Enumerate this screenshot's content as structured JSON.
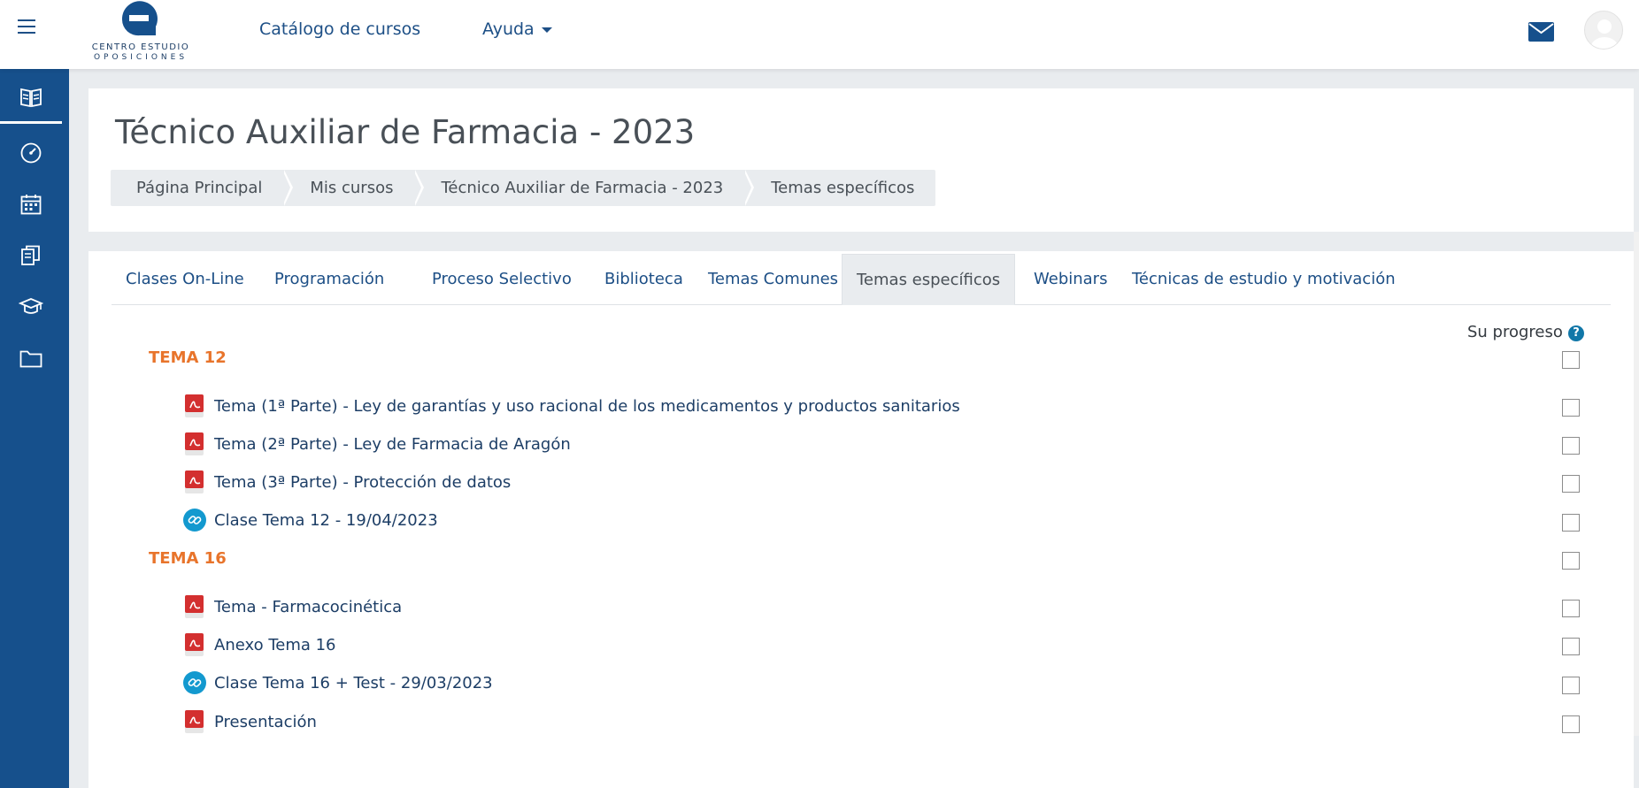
{
  "navbar": {
    "logo_line1": "CENTRO ESTUDIO",
    "logo_line2": "OPOSICIONES",
    "catalog_label": "Catálogo de cursos",
    "help_label": "Ayuda"
  },
  "rail": {
    "items": [
      {
        "icon": "book-open-icon",
        "active": true
      },
      {
        "icon": "dashboard-icon"
      },
      {
        "icon": "calendar-icon"
      },
      {
        "icon": "files-icon"
      },
      {
        "icon": "graduation-cap-icon"
      },
      {
        "icon": "folder-icon"
      }
    ]
  },
  "header": {
    "title": "Técnico Auxiliar de Farmacia - 2023",
    "breadcrumb": [
      "Página Principal",
      "Mis cursos",
      "Técnico Auxiliar de Farmacia - 2023",
      "Temas específicos"
    ]
  },
  "tabs": [
    "Clases On-Line",
    "Programación",
    "Proceso Selectivo",
    "Biblioteca",
    "Temas Comunes",
    "Temas específicos",
    "Webinars",
    "Técnicas de estudio y motivación"
  ],
  "active_tab": "Temas específicos",
  "progress_label": "Su progreso",
  "sections": [
    {
      "title": "TEMA 12",
      "activities": [
        {
          "type": "pdf",
          "label": "Tema (1ª Parte) - Ley de garantías y uso racional de los medicamentos y productos sanitarios"
        },
        {
          "type": "pdf",
          "label": "Tema (2ª Parte) - Ley de Farmacia de Aragón"
        },
        {
          "type": "pdf",
          "label": "Tema (3ª Parte) - Protección de datos"
        },
        {
          "type": "url",
          "label": "Clase Tema 12 - 19/04/2023"
        }
      ]
    },
    {
      "title": "TEMA 16",
      "activities": [
        {
          "type": "pdf",
          "label": "Tema - Farmacocinética"
        },
        {
          "type": "pdf",
          "label": "Anexo Tema 16"
        },
        {
          "type": "url",
          "label": "Clase Tema 16 + Test - 29/03/2023"
        },
        {
          "type": "pdf",
          "label": "Presentación"
        }
      ]
    }
  ],
  "colors": {
    "brand": "#16508c",
    "section_title": "#e8742b",
    "link": "#1d4f86"
  }
}
